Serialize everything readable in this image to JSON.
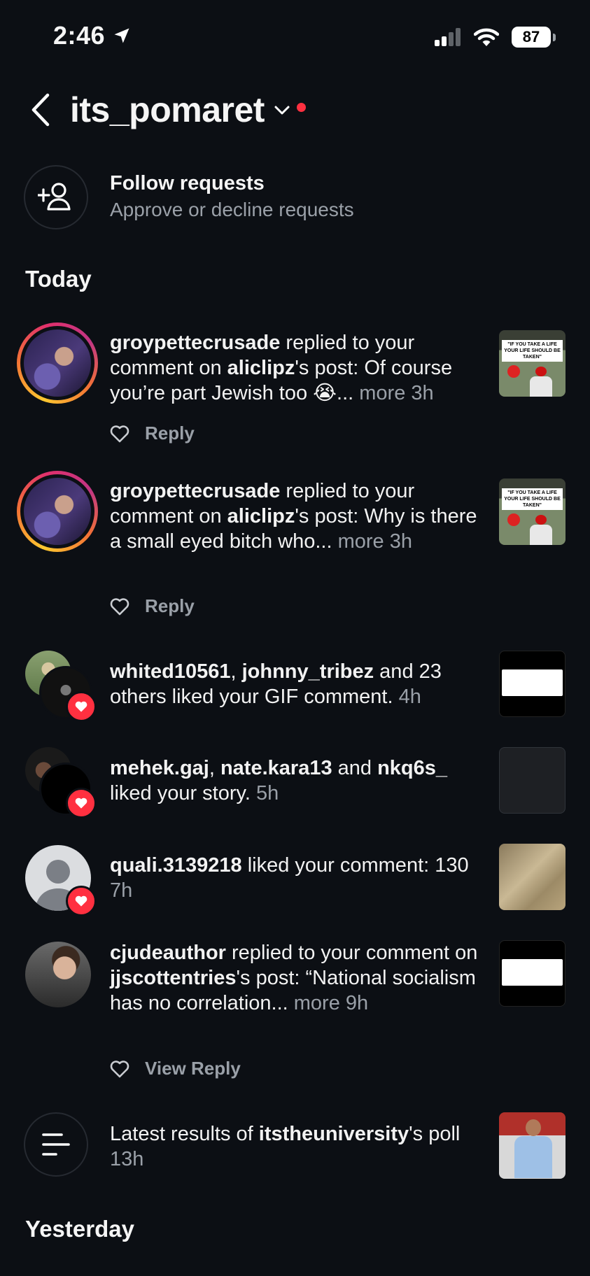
{
  "status_bar": {
    "time": "2:46",
    "battery": "87"
  },
  "header": {
    "username": "its_pomaret"
  },
  "follow_requests": {
    "title": "Follow requests",
    "subtitle": "Approve or decline requests"
  },
  "sections": {
    "today": "Today",
    "yesterday": "Yesterday"
  },
  "notifications": [
    {
      "user": "groypettecrusade",
      "t1": " replied to your comment on ",
      "user2": "aliclipz",
      "t2": "'s post: Of course you’re part Jewish too 😭...",
      "more": " more",
      "time": " 3h",
      "action": "Reply",
      "thumb_caption": "\"IF YOU TAKE A LIFE YOUR LIFE SHOULD BE TAKEN\""
    },
    {
      "user": "groypettecrusade",
      "t1": " replied to your comment on ",
      "user2": "aliclipz",
      "t2": "'s post: Why is there a small eyed bitch who...",
      "more": " more",
      "time": " 3h",
      "action": "Reply",
      "thumb_caption": "\"IF YOU TAKE A LIFE YOUR LIFE SHOULD BE TAKEN\""
    },
    {
      "user": "whited10561",
      "sep": ", ",
      "user2": "johnny_tribez",
      "t1": " and 23 others liked your GIF comment.",
      "time": " 4h"
    },
    {
      "user": "mehek.gaj",
      "sep": ", ",
      "user2": "nate.kara13",
      "t1": " and ",
      "user3": "nkq6s_",
      "t2": " liked your story.",
      "time": " 5h"
    },
    {
      "user": "quali.3139218",
      "t1": " liked your comment: 130",
      "time": " 7h"
    },
    {
      "user": "cjudeauthor",
      "t1": " replied to your comment on ",
      "user2": "jjscottentries",
      "t2": "'s post: “National socialism has no correlation...",
      "more": " more",
      "time": " 9h",
      "action": "View Reply"
    },
    {
      "t1": "Latest results of ",
      "user": "itstheuniversity",
      "t2": "'s poll",
      "time": " 13h"
    }
  ]
}
